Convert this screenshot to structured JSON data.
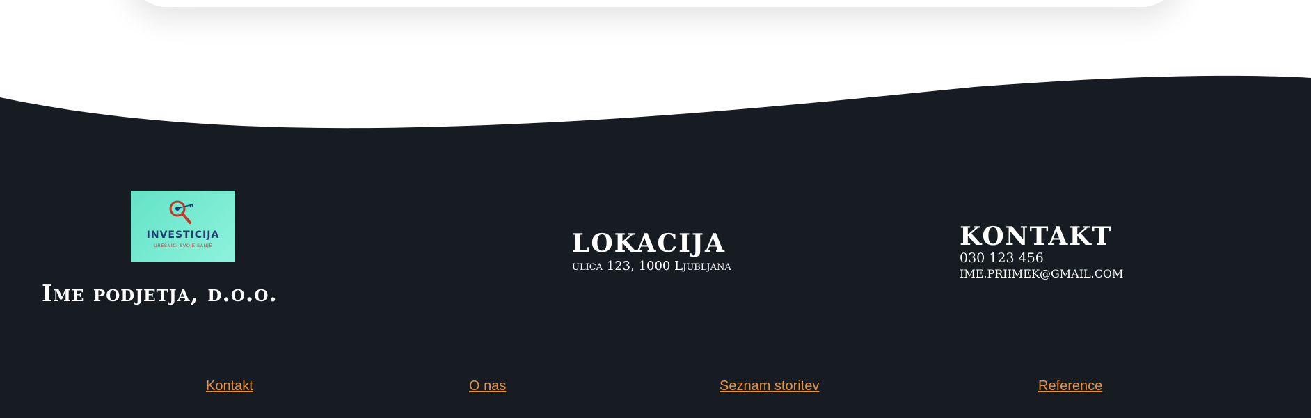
{
  "colors": {
    "footer_bg": "#171b22",
    "link": "#e8913d",
    "logo_bg": "#6fe9cf",
    "logo_title": "#1f3b6e",
    "logo_accent": "#c0392b"
  },
  "logo": {
    "title": "INVESTICIJA",
    "subtitle": "URESNICI SVOJE SANJE",
    "icon": "magnifier-key-icon"
  },
  "company": {
    "name": "Ime podjetja, d.o.o."
  },
  "location": {
    "heading": "LOKACIJA",
    "address": "ulica 123, 1000 Ljubljana"
  },
  "contact": {
    "heading": "KONTAKT",
    "phone": "030 123 456",
    "email": "ime.priimek@gmail.com"
  },
  "nav": {
    "links": [
      {
        "label": "Kontakt"
      },
      {
        "label": "O nas"
      },
      {
        "label": "Seznam storitev"
      },
      {
        "label": "Reference"
      }
    ]
  }
}
